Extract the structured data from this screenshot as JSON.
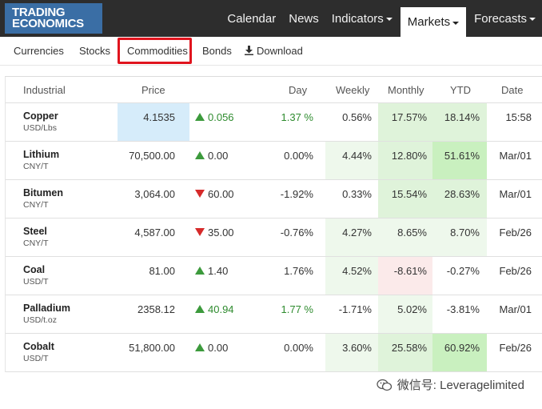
{
  "brand": {
    "line1": "TRADING",
    "line2": "ECONOMICS"
  },
  "nav": {
    "items": [
      {
        "label": "Calendar",
        "dropdown": false,
        "active": false
      },
      {
        "label": "News",
        "dropdown": false,
        "active": false
      },
      {
        "label": "Indicators",
        "dropdown": true,
        "active": false
      },
      {
        "label": "Markets",
        "dropdown": true,
        "active": true
      },
      {
        "label": "Forecasts",
        "dropdown": true,
        "active": false
      }
    ]
  },
  "subnav": {
    "items": [
      "Currencies",
      "Stocks",
      "Commodities",
      "Bonds"
    ],
    "download_label": "Download",
    "selected": "Commodities"
  },
  "table": {
    "headers": [
      "Industrial",
      "Price",
      "Day",
      "Weekly",
      "Monthly",
      "YTD",
      "Date"
    ],
    "rows": [
      {
        "name": "Copper",
        "unit": "USD/Lbs",
        "price": "4.1535",
        "direction": "up",
        "change": "0.056",
        "day": "1.37 %",
        "weekly": "0.56%",
        "monthly": "17.57%",
        "ytd": "18.14%",
        "date": "15:58"
      },
      {
        "name": "Lithium",
        "unit": "CNY/T",
        "price": "70,500.00",
        "direction": "up",
        "change": "0.00",
        "day": "0.00%",
        "weekly": "4.44%",
        "monthly": "12.80%",
        "ytd": "51.61%",
        "date": "Mar/01"
      },
      {
        "name": "Bitumen",
        "unit": "CNY/T",
        "price": "3,064.00",
        "direction": "down",
        "change": "60.00",
        "day": "-1.92%",
        "weekly": "0.33%",
        "monthly": "15.54%",
        "ytd": "28.63%",
        "date": "Mar/01"
      },
      {
        "name": "Steel",
        "unit": "CNY/T",
        "price": "4,587.00",
        "direction": "down",
        "change": "35.00",
        "day": "-0.76%",
        "weekly": "4.27%",
        "monthly": "8.65%",
        "ytd": "8.70%",
        "date": "Feb/26"
      },
      {
        "name": "Coal",
        "unit": "USD/T",
        "price": "81.00",
        "direction": "up",
        "change": "1.40",
        "day": "1.76%",
        "weekly": "4.52%",
        "monthly": "-8.61%",
        "ytd": "-0.27%",
        "date": "Feb/26"
      },
      {
        "name": "Palladium",
        "unit": "USD/t.oz",
        "price": "2358.12",
        "direction": "up",
        "change": "40.94",
        "day": "1.77 %",
        "weekly": "-1.71%",
        "monthly": "5.02%",
        "ytd": "-3.81%",
        "date": "Mar/01"
      },
      {
        "name": "Cobalt",
        "unit": "USD/T",
        "price": "51,800.00",
        "direction": "up",
        "change": "0.00",
        "day": "0.00%",
        "weekly": "3.60%",
        "monthly": "25.58%",
        "ytd": "60.92%",
        "date": "Feb/26"
      }
    ]
  },
  "colors": {
    "price_highlight": "#d6ecfa",
    "green_light": "#eef8ec",
    "green_mid": "#dff3da",
    "green_strong": "#c9f0bf",
    "red_light": "#fbeaea",
    "up_arrow": "#3c9a3c",
    "down_arrow": "#d62a2a",
    "highlight_box": "#e0141e"
  },
  "watermark": {
    "text": "微信号: Leveragelimited"
  }
}
